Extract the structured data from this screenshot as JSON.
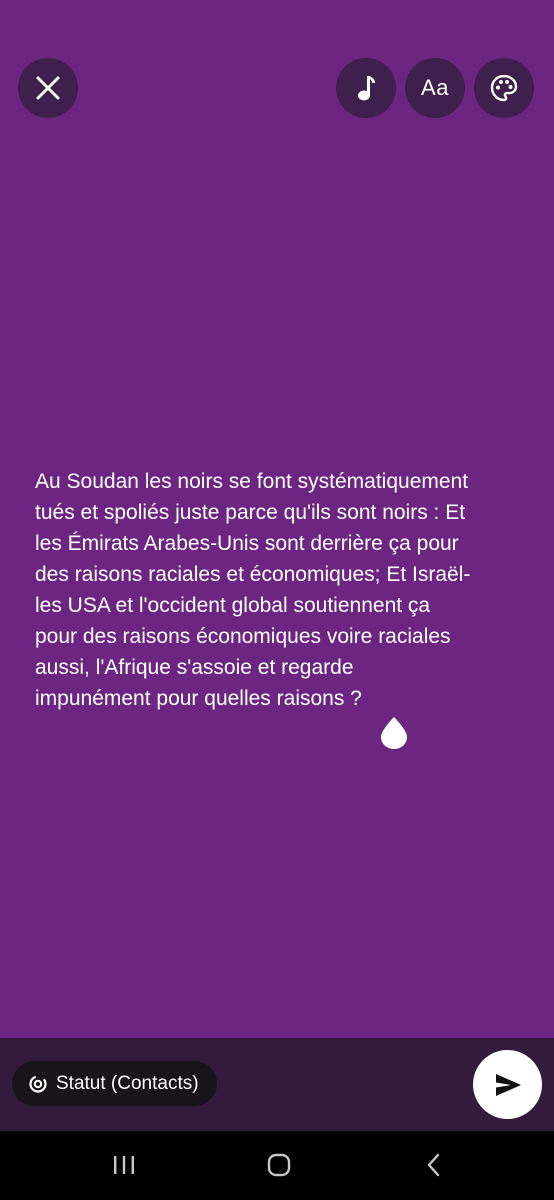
{
  "toolbar": {
    "close_icon": "close-icon",
    "music_icon": "music-note-icon",
    "font_label": "Aa",
    "palette_icon": "palette-icon"
  },
  "status": {
    "text": "Au Soudan les noirs se font systématiquement\ntués et spoliés juste parce qu'ils sont noirs : Et\nles Émirats Arabes-Unis sont derrière ça pour\ndes raisons raciales et économiques; Et Israël-\nles USA et l'occident global soutiennent ça\npour des raisons économiques voire raciales\naussi,  l'Afrique s'assoie et regarde\nimpunément pour quelles raisons ?",
    "background_color": "#6c2580"
  },
  "bottom": {
    "audience_label": "Statut (Contacts)",
    "send_icon": "send-icon"
  },
  "nav": {
    "recents_icon": "recents-icon",
    "home_icon": "home-icon",
    "back_icon": "back-icon"
  }
}
